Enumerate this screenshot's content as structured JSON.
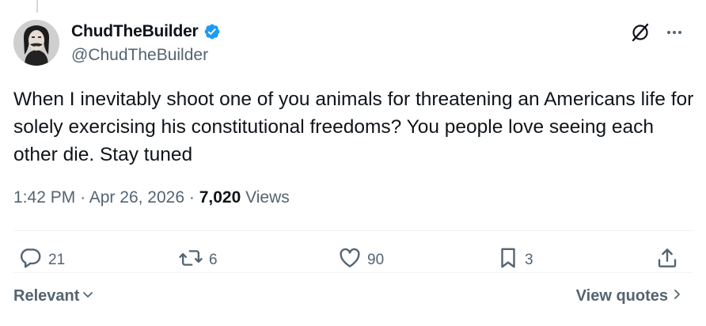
{
  "user": {
    "display_name": "ChudTheBuilder",
    "handle": "@ChudTheBuilder",
    "verified": true
  },
  "tweet": {
    "text": "When I inevitably shoot one of you animals for threatening an Americans life for solely exercising his constitutional freedoms? You people love seeing each other die. Stay tuned",
    "time": "1:42 PM",
    "separator": "·",
    "date": "Apr 26, 2026",
    "views_count": "7,020",
    "views_label": "Views"
  },
  "actions": {
    "replies": "21",
    "reposts": "6",
    "likes": "90",
    "bookmarks": "3"
  },
  "footer": {
    "sort_label": "Relevant",
    "view_quotes_label": "View quotes"
  },
  "colors": {
    "text_primary": "#0f1419",
    "text_secondary": "#536471",
    "verified_blue": "#1d9bf0",
    "divider": "#eff3f4"
  },
  "icons": [
    "grok-icon",
    "more-icon",
    "reply-icon",
    "repost-icon",
    "like-icon",
    "bookmark-icon",
    "share-icon",
    "chevron-down-icon",
    "chevron-right-icon",
    "verified-badge-icon"
  ]
}
